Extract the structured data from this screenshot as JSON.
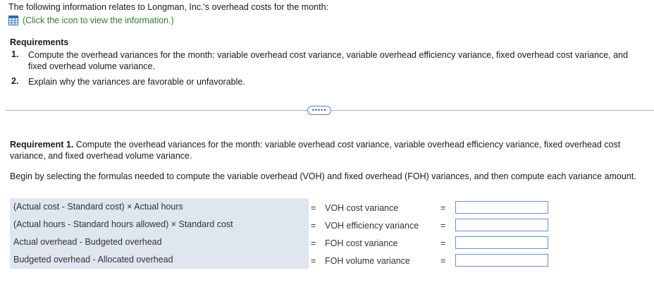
{
  "intro": {
    "text": "The following information relates to Longman, Inc.'s overhead costs for the month:",
    "link_text": "(Click the icon to view the information.)",
    "icon": "table-grid-icon"
  },
  "requirements": {
    "heading": "Requirements",
    "items": [
      {
        "num": "1.",
        "text": "Compute the overhead variances for the month: variable overhead cost variance, variable overhead efficiency variance, fixed overhead cost variance, and fixed overhead volume variance."
      },
      {
        "num": "2.",
        "text": "Explain why the variances are favorable or unfavorable."
      }
    ]
  },
  "divider": {
    "more_label": "•••••"
  },
  "requirement1": {
    "label": "Requirement 1.",
    "text": " Compute the overhead variances for the month: variable overhead cost variance, variable overhead efficiency variance, fixed overhead cost variance, and fixed overhead volume variance."
  },
  "instruction": "Begin by selecting the formulas needed to compute the variable overhead (VOH) and fixed overhead (FOH) variances, and then compute each variance amount.",
  "rows": [
    {
      "formula": "(Actual cost - Standard cost) × Actual hours",
      "eq": "=",
      "variance": "VOH cost variance",
      "eq2": "=",
      "value": ""
    },
    {
      "formula": "(Actual hours - Standard hours allowed) × Standard cost",
      "eq": "=",
      "variance": "VOH efficiency variance",
      "eq2": "=",
      "value": ""
    },
    {
      "formula": "Actual overhead - Budgeted overhead",
      "eq": "=",
      "variance": "FOH cost variance",
      "eq2": "=",
      "value": ""
    },
    {
      "formula": "Budgeted overhead - Allocated overhead",
      "eq": "=",
      "variance": "FOH volume variance",
      "eq2": "=",
      "value": ""
    }
  ],
  "colors": {
    "link": "#2e7d32",
    "panel": "#dfe6f0",
    "input_border": "#6b8fc7"
  }
}
